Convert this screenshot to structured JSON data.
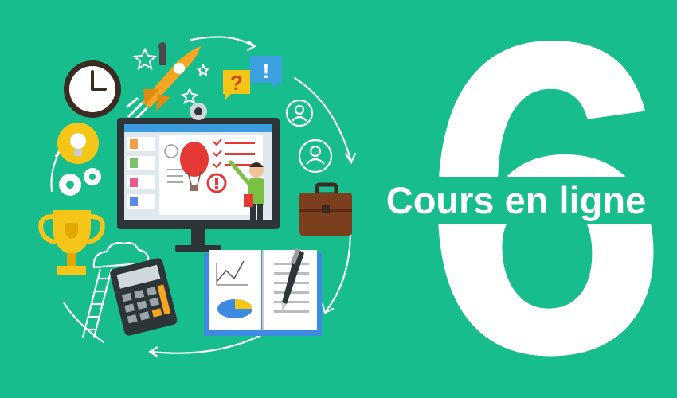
{
  "banner": {
    "number": "6",
    "headline": "Cours en ligne",
    "background_color": "#17bd8c"
  },
  "illustration": {
    "icons": [
      "clock-icon",
      "rocket-icon",
      "question-bubble-icon",
      "exclamation-bubble-icon",
      "lightbulb-icon",
      "gears-icon",
      "trophy-icon",
      "computer-monitor-icon",
      "webcam-icon",
      "teacher-icon",
      "hot-air-balloon-icon",
      "student-avatar-icon",
      "briefcase-icon",
      "open-book-icon",
      "pen-icon",
      "calculator-icon",
      "ladder-icon",
      "cloud-icon",
      "cycle-arrows-icon"
    ]
  }
}
